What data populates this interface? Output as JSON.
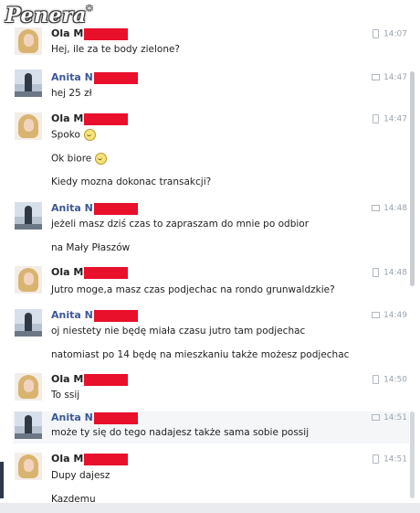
{
  "watermark": "Penera",
  "messages": [
    {
      "name": "Ola M",
      "time": "14:07",
      "lines": [
        "Hej, ile za te body zielone?"
      ]
    },
    {
      "name": "Anita N",
      "time": "14:47",
      "lines": [
        "hej 25 zł"
      ]
    },
    {
      "name": "Ola M",
      "time": "14:47",
      "lines": [
        "Spoko",
        "Ok biore",
        "Kiedy mozna dokonac transakcji?"
      ]
    },
    {
      "name": "Anita N",
      "time": "14:48",
      "lines": [
        "jeżeli masz dziś czas to zapraszam do mnie po odbior",
        "na Mały Płaszów"
      ]
    },
    {
      "name": "Ola M",
      "time": "14:48",
      "lines": [
        "Jutro moge,a masz czas podjechac na rondo grunwaldzkie?"
      ]
    },
    {
      "name": "Anita N",
      "time": "14:49",
      "lines": [
        "oj niestety nie będę miała czasu jutro tam podjechac",
        "natomiast po 14 będę na mieszkaniu także możesz podjechac"
      ]
    },
    {
      "name": "Ola M",
      "time": "14:50",
      "lines": [
        "To ssij"
      ]
    },
    {
      "name": "Anita N",
      "time": "14:51",
      "lines": [
        "może ty się do tego nadajesz także sama sobie possij"
      ]
    },
    {
      "name": "Ola M",
      "time": "14:51",
      "lines": [
        "Dupy dajesz",
        "Kazdemu"
      ]
    }
  ]
}
